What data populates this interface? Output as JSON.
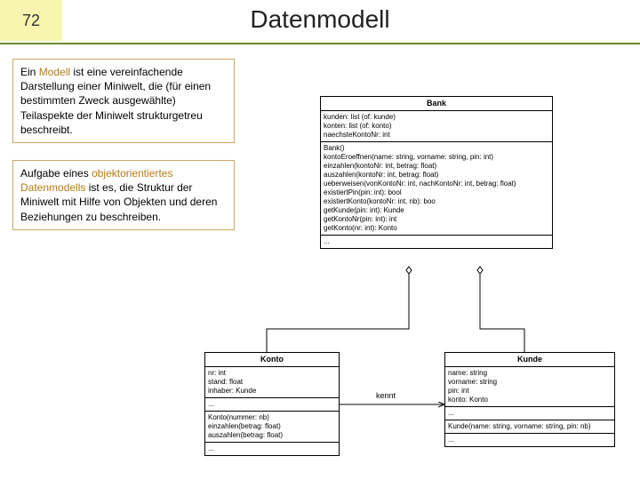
{
  "page_number": "72",
  "title": "Datenmodell",
  "para1_pre": "Ein ",
  "para1_em": "Modell",
  "para1_post": " ist eine vereinfachende Darstellung einer Miniwelt, die (für einen bestimmten Zweck ausgewählte) Teilaspekte der Miniwelt strukturgetreu beschreibt.",
  "para2_pre": "Aufgabe eines ",
  "para2_em": "objektorientiertes Datenmodells",
  "para2_post": " ist es, die Struktur der Miniwelt mit Hilfe von Objekten und deren Beziehungen zu beschreiben.",
  "bank": {
    "name": "Bank",
    "attrs": "kunden: list (of: kunde)\nkonten: list (of: konto)\nnaechsteKontoNr: int",
    "ops": "Bank()\nkontoEroeffnen(name: string, vorname: string, pin: int)\neinzahlen(kontoNr: int, betrag: float)\nauszahlen(kontoNr: int, betrag: float)\nueberweisen(vonKontoNr: int, nachKontoNr: int, betrag: float)\nexistiertPin(pin: int): bool\nexistiertKonto(kontoNr: int, nb): boo\ngetKunde(pin: int): Kunde\ngetKontoNr(pin: int): int\ngetKonto(nr: int): Konto",
    "ellipsis": "..."
  },
  "konto": {
    "name": "Konto",
    "attrs": "nr: int\nstand: float\ninhaber: Kunde",
    "attrs_ellipsis": "...",
    "ops": "Konto(nummer: nb)\neinzahlen(betrag: float)\nauszahlen(betrag: float)",
    "ops_ellipsis": "..."
  },
  "kunde": {
    "name": "Kunde",
    "attrs": "name: string\nvorname: string\npin: int\nkonto: Konto",
    "attrs_ellipsis": "...",
    "ops": "Kunde(name: string, vorname: string, pin: nb)",
    "ops_ellipsis": "..."
  },
  "assoc_label": "kennt"
}
